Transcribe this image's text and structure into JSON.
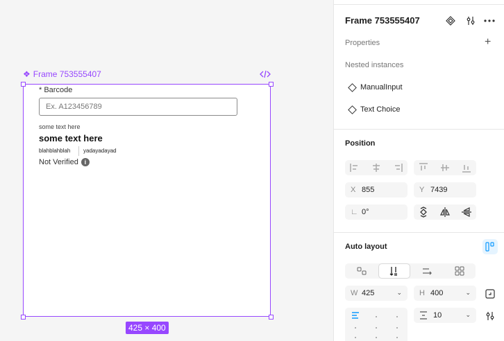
{
  "canvas": {
    "frame_label": "Frame 753555407",
    "size_badge": "425 × 400",
    "component": {
      "field_label": "* Barcode",
      "input_placeholder": "Ex. A123456789",
      "small_text": "some text here",
      "bold_text": "some text here",
      "kv_left": "blahblahblah",
      "kv_right": "yadayadayad",
      "status": "Not Verified",
      "info_glyph": "i"
    }
  },
  "panel": {
    "title": "Frame 753555407",
    "properties_label": "Properties",
    "nested_label": "Nested instances",
    "instances": [
      "ManualInput",
      "Text Choice"
    ],
    "position": {
      "title": "Position",
      "x_key": "X",
      "x_value": "855",
      "y_key": "Y",
      "y_value": "7439",
      "rotation_key": "∟",
      "rotation_value": "0°"
    },
    "auto_layout": {
      "title": "Auto layout",
      "w_key": "W",
      "w_value": "425",
      "h_key": "H",
      "h_value": "400",
      "gap_value": "10"
    }
  },
  "colors": {
    "accent": "#9747ff",
    "selection_blue": "#0d99ff"
  },
  "icons": [
    "component-icon",
    "code-icon",
    "component-set-icon",
    "adjust-icon",
    "more-icon",
    "plus-icon",
    "align-left-icon",
    "align-center-h-icon",
    "align-right-icon",
    "align-top-icon",
    "align-center-v-icon",
    "align-bottom-icon",
    "rotate-icon",
    "flip-h-icon",
    "flip-v-icon",
    "auto-layout-icon",
    "resize-icon",
    "spacing-icon",
    "padding-icon"
  ]
}
